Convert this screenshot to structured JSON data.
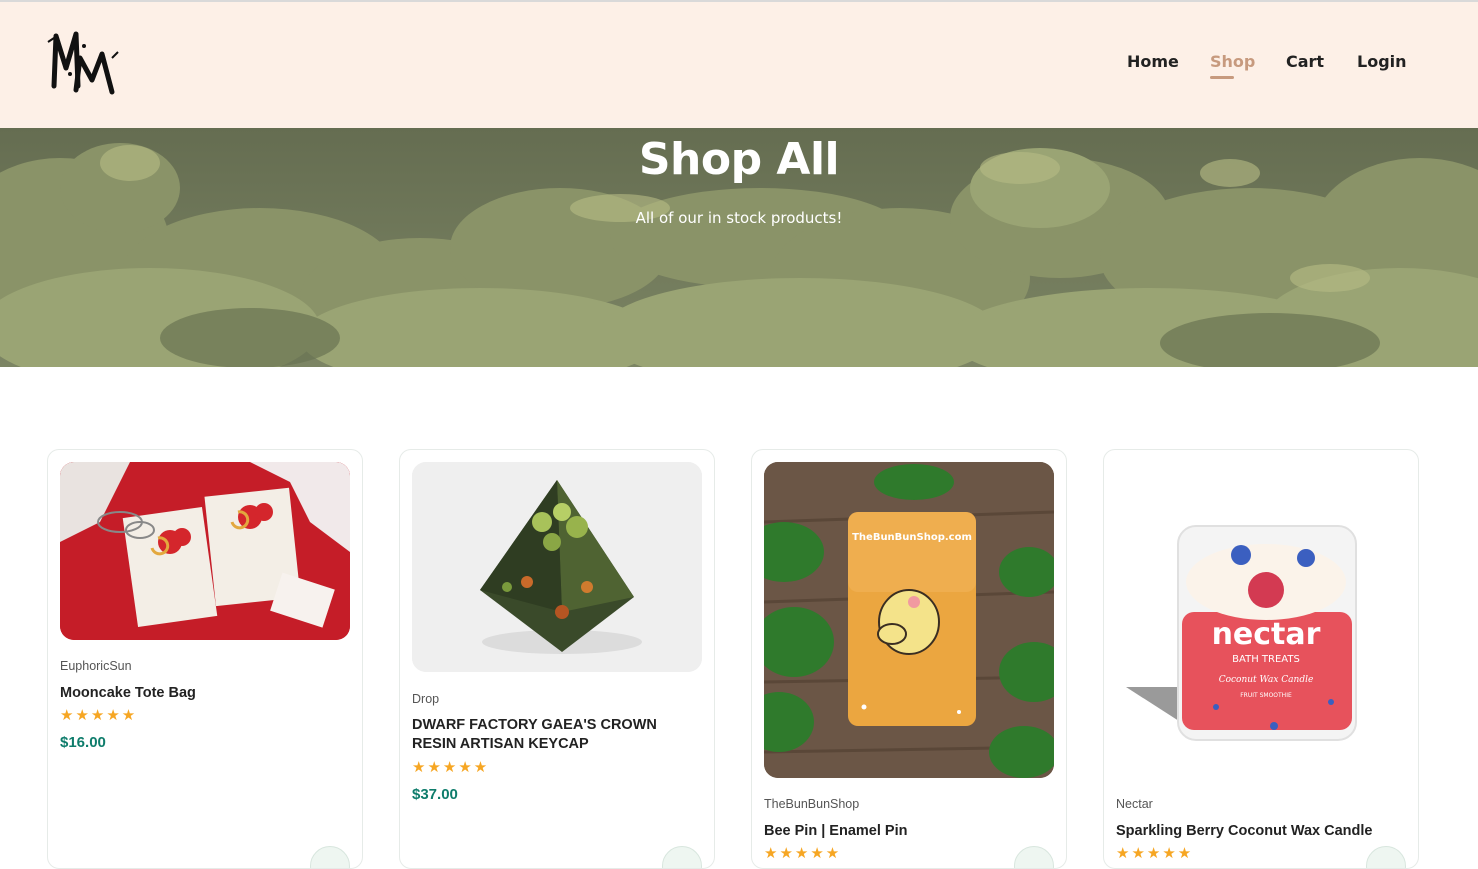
{
  "header": {
    "logo_text": "MM",
    "nav": [
      {
        "label": "Home",
        "active": false
      },
      {
        "label": "Shop",
        "active": true
      },
      {
        "label": "Cart",
        "active": false
      },
      {
        "label": "Login",
        "active": false
      }
    ]
  },
  "hero": {
    "title": "Shop All",
    "subtitle": "All of our in stock products!"
  },
  "products": [
    {
      "brand": "EuphoricSun",
      "name": "Mooncake Tote Bag",
      "rating": 5,
      "stars": "★★★★★",
      "price": "$16.00"
    },
    {
      "brand": "Drop",
      "name": "DWARF FACTORY GAEA'S CROWN RESIN ARTISAN KEYCAP",
      "rating": 5,
      "stars": "★★★★★",
      "price": "$37.00"
    },
    {
      "brand": "TheBunBunShop",
      "name": "Bee Pin | Enamel Pin",
      "rating": 5,
      "stars": "★★★★★",
      "price": "",
      "image_text": "TheBunBunShop.com"
    },
    {
      "brand": "Nectar",
      "name": "Sparkling Berry Coconut Wax Candle",
      "rating": 5,
      "stars": "★★★★★",
      "price": "",
      "image_text": {
        "logo": "nectar",
        "line1": "BATH TREATS",
        "line2": "Coconut Wax Candle",
        "line3": "FRUIT SMOOTHIE"
      }
    }
  ],
  "colors": {
    "header_bg": "#fdf0e7",
    "nav_active": "#c79a7e",
    "price": "#0e7c6b",
    "star": "#f6a623",
    "hero_sky": "#6c7457"
  },
  "icons": [
    "logo-icon",
    "star-icon",
    "cart-icon"
  ]
}
